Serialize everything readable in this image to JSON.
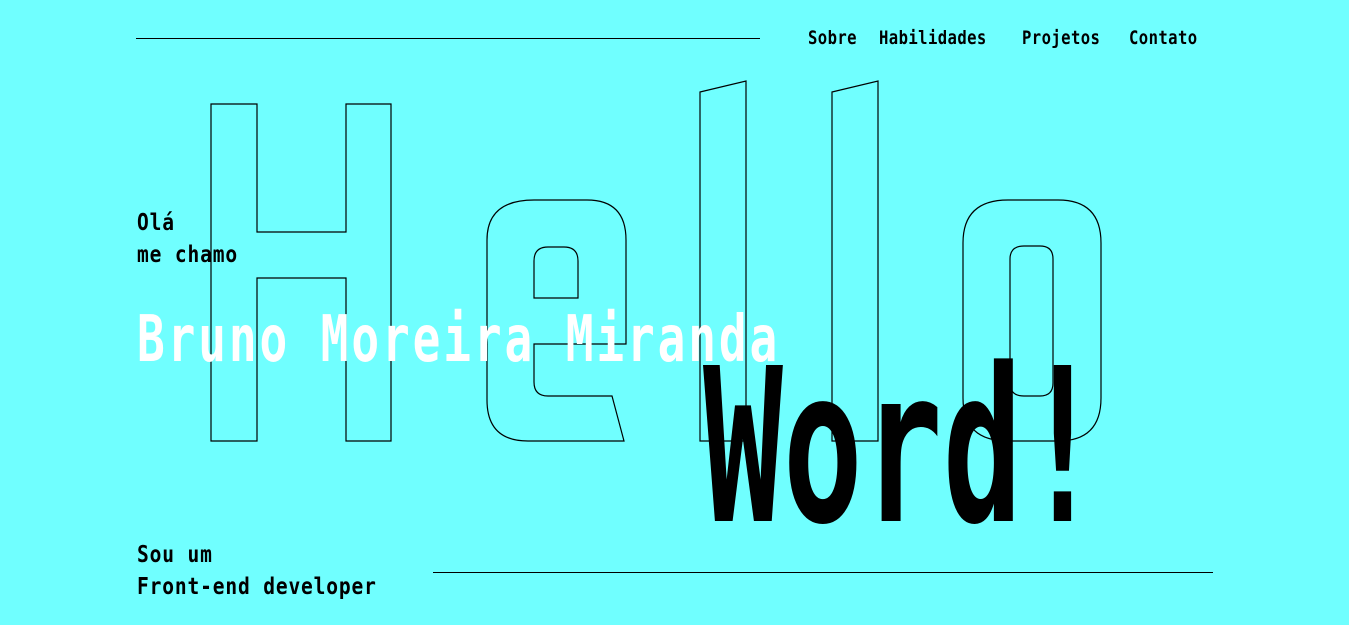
{
  "nav": {
    "items": [
      {
        "label": "Sobre"
      },
      {
        "label": "Habilidades"
      },
      {
        "label": "Projetos"
      },
      {
        "label": "Contato"
      }
    ]
  },
  "hero": {
    "outline_word": "Hello",
    "greeting_line1": "Olá",
    "greeting_line2": "me chamo",
    "name": "Bruno Moreira Miranda",
    "headline": "Word!",
    "role_line1": "Sou um",
    "role_line2": "Front-end developer"
  },
  "colors": {
    "background": "#70FFFF",
    "text": "#000000",
    "name": "#FFFFFF"
  }
}
